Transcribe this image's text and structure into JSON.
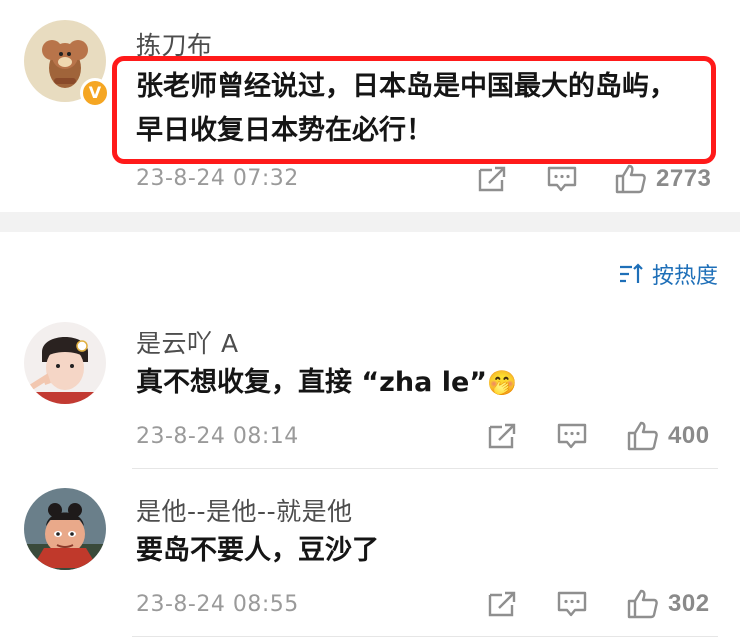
{
  "post": {
    "username": "拣刀布",
    "text_line1": "张老师曾经说过，日本岛是中国最大的岛屿，",
    "text_line2": "早日收复日本势在必行！",
    "time": "23-8-24 07:32",
    "likes": "2773",
    "verified_badge": "V"
  },
  "sort": {
    "label": "按热度",
    "icon": "sort-icon"
  },
  "comments": [
    {
      "username": "是云吖 A",
      "text": "真不想收复，直接 “zha le”",
      "emoji": "🤭",
      "time": "23-8-24 08:14",
      "likes": "400"
    },
    {
      "username": "是他--是他--就是他",
      "text": "要岛不要人，豆沙了",
      "time": "23-8-24 08:55",
      "likes": "302"
    }
  ],
  "colors": {
    "highlight": "#ff1a1a",
    "link": "#1e6fb8",
    "badge": "#f5a623"
  }
}
